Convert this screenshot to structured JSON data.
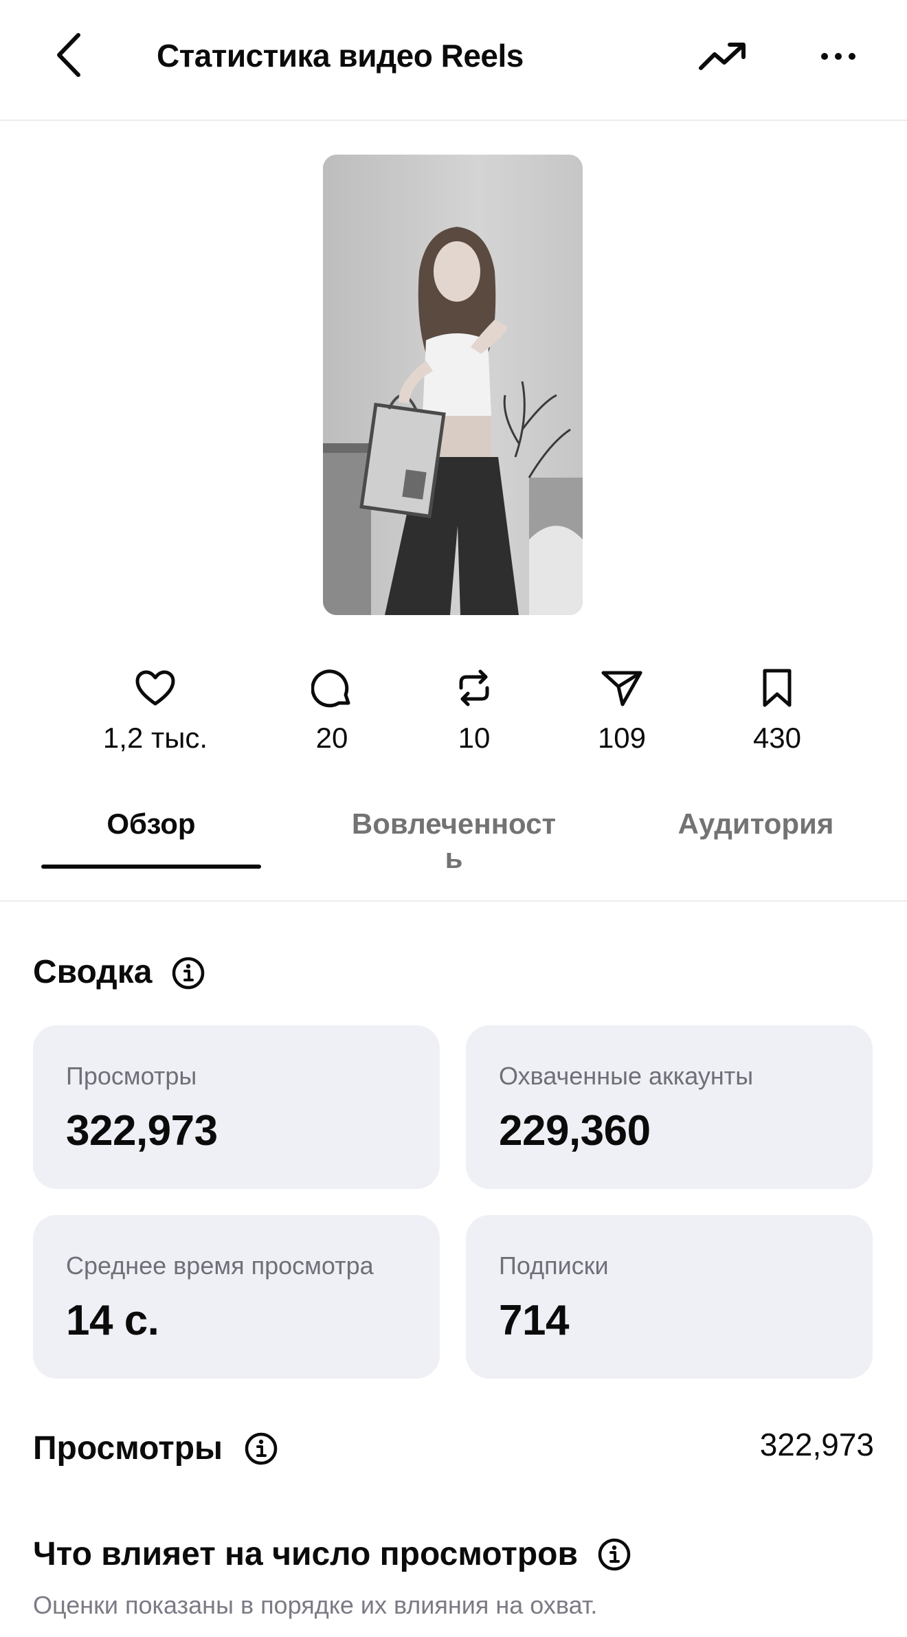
{
  "header": {
    "title": "Статистика видео Reels",
    "icons": {
      "back": "chevron-left-icon",
      "trend": "trending-up-icon",
      "more": "more-horizontal-icon"
    }
  },
  "reel": {
    "thumbnail": "reel-thumbnail-image"
  },
  "stats": [
    {
      "icon": "heart-icon",
      "value": "1,2 тыс."
    },
    {
      "icon": "comment-icon",
      "value": "20"
    },
    {
      "icon": "repost-icon",
      "value": "10"
    },
    {
      "icon": "share-icon",
      "value": "109"
    },
    {
      "icon": "bookmark-icon",
      "value": "430"
    }
  ],
  "tabs": [
    {
      "label": "Обзор",
      "active": true
    },
    {
      "label": "Вовлеченность",
      "active": false
    },
    {
      "label": "Аудитория",
      "active": false
    }
  ],
  "summary": {
    "title": "Сводка",
    "cards": [
      {
        "label": "Просмотры",
        "value": "322,973"
      },
      {
        "label": "Охваченные аккаунты",
        "value": "229,360"
      },
      {
        "label": "Среднее время просмотра",
        "value": "14 с."
      },
      {
        "label": "Подписки",
        "value": "714"
      }
    ]
  },
  "views": {
    "title": "Просмотры",
    "total": "322,973"
  },
  "influence": {
    "title": "Что влияет на число просмотров",
    "note": "Оценки показаны в порядке их влияния на охват."
  },
  "colors": {
    "card_bg": "#eff0f5",
    "muted_text": "#737373",
    "divider": "#ececec"
  }
}
